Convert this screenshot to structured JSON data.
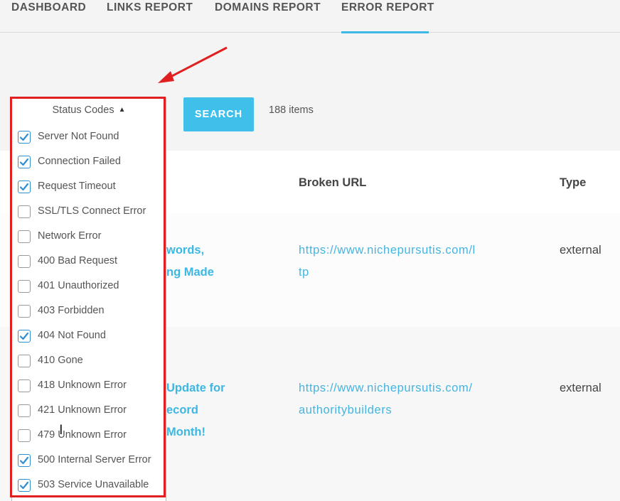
{
  "nav": {
    "tabs": [
      {
        "label": "DASHBOARD"
      },
      {
        "label": "LINKS REPORT"
      },
      {
        "label": "DOMAINS REPORT"
      },
      {
        "label": "ERROR REPORT",
        "active": true
      }
    ]
  },
  "toolbar": {
    "search_label": "SEARCH",
    "items_count": "188 items"
  },
  "status_filter": {
    "header": "Status Codes",
    "caret_icon": "caret-up-icon",
    "options": [
      {
        "label": "Server Not Found",
        "checked": true
      },
      {
        "label": "Connection Failed",
        "checked": true
      },
      {
        "label": "Request Timeout",
        "checked": true
      },
      {
        "label": "SSL/TLS Connect Error",
        "checked": false
      },
      {
        "label": "Network Error",
        "checked": false
      },
      {
        "label": "400 Bad Request",
        "checked": false
      },
      {
        "label": "401 Unauthorized",
        "checked": false
      },
      {
        "label": "403 Forbidden",
        "checked": false
      },
      {
        "label": "404 Not Found",
        "checked": true
      },
      {
        "label": "410 Gone",
        "checked": false
      },
      {
        "label": "418 Unknown Error",
        "checked": false
      },
      {
        "label": "421 Unknown Error",
        "checked": false
      },
      {
        "label": "479 Unknown Error",
        "checked": false
      },
      {
        "label": "500 Internal Server Error",
        "checked": true
      },
      {
        "label": "503 Service Unavailable",
        "checked": true
      }
    ]
  },
  "table": {
    "columns": {
      "broken_url": "Broken URL",
      "type": "Type"
    },
    "rows": [
      {
        "title_lines": [
          "words,",
          "ng Made"
        ],
        "url_lines": [
          "https://www.nichepursutis.com/l",
          "tp"
        ],
        "type": "external"
      },
      {
        "title_lines": [
          "Update for",
          "ecord",
          "Month!"
        ],
        "url_lines": [
          "https://www.nichepursutis.com/",
          "authoritybuilders"
        ],
        "type": "external"
      }
    ]
  },
  "colors": {
    "accent": "#3db7e4",
    "annotation": "#e02020",
    "checkbox": "#2f8fd6"
  }
}
